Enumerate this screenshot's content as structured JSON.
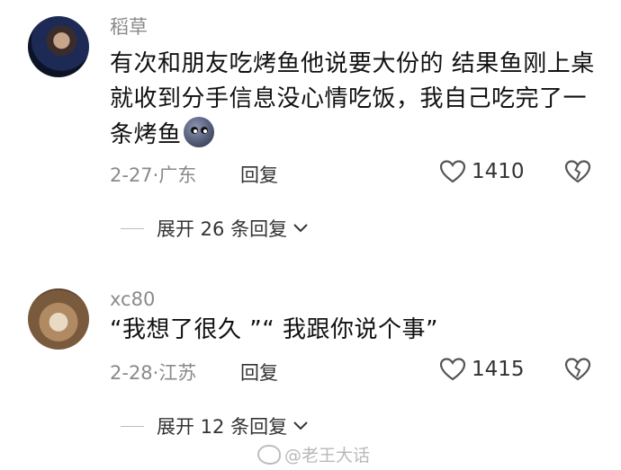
{
  "comments": [
    {
      "username": "稻草",
      "text": "有次和朋友吃烤鱼他说要大份的 结果鱼刚上桌就收到分手信息没心情吃饭，我自己吃完了一条烤鱼",
      "emoji": "face-emoji",
      "date_location": "2-27·广东",
      "reply_label": "回复",
      "likes": "1410",
      "expand_label": "展开 26 条回复"
    },
    {
      "username": "xc80",
      "text": "“我想了很久 ”“ 我跟你说个事”",
      "date_location": "2-28·江苏",
      "reply_label": "回复",
      "likes": "1415",
      "expand_label": "展开 12 条回复"
    }
  ],
  "watermark": "@老王大话",
  "colors": {
    "meta_gray": "#8a8a8a",
    "text": "#111111",
    "background": "#ffffff"
  }
}
